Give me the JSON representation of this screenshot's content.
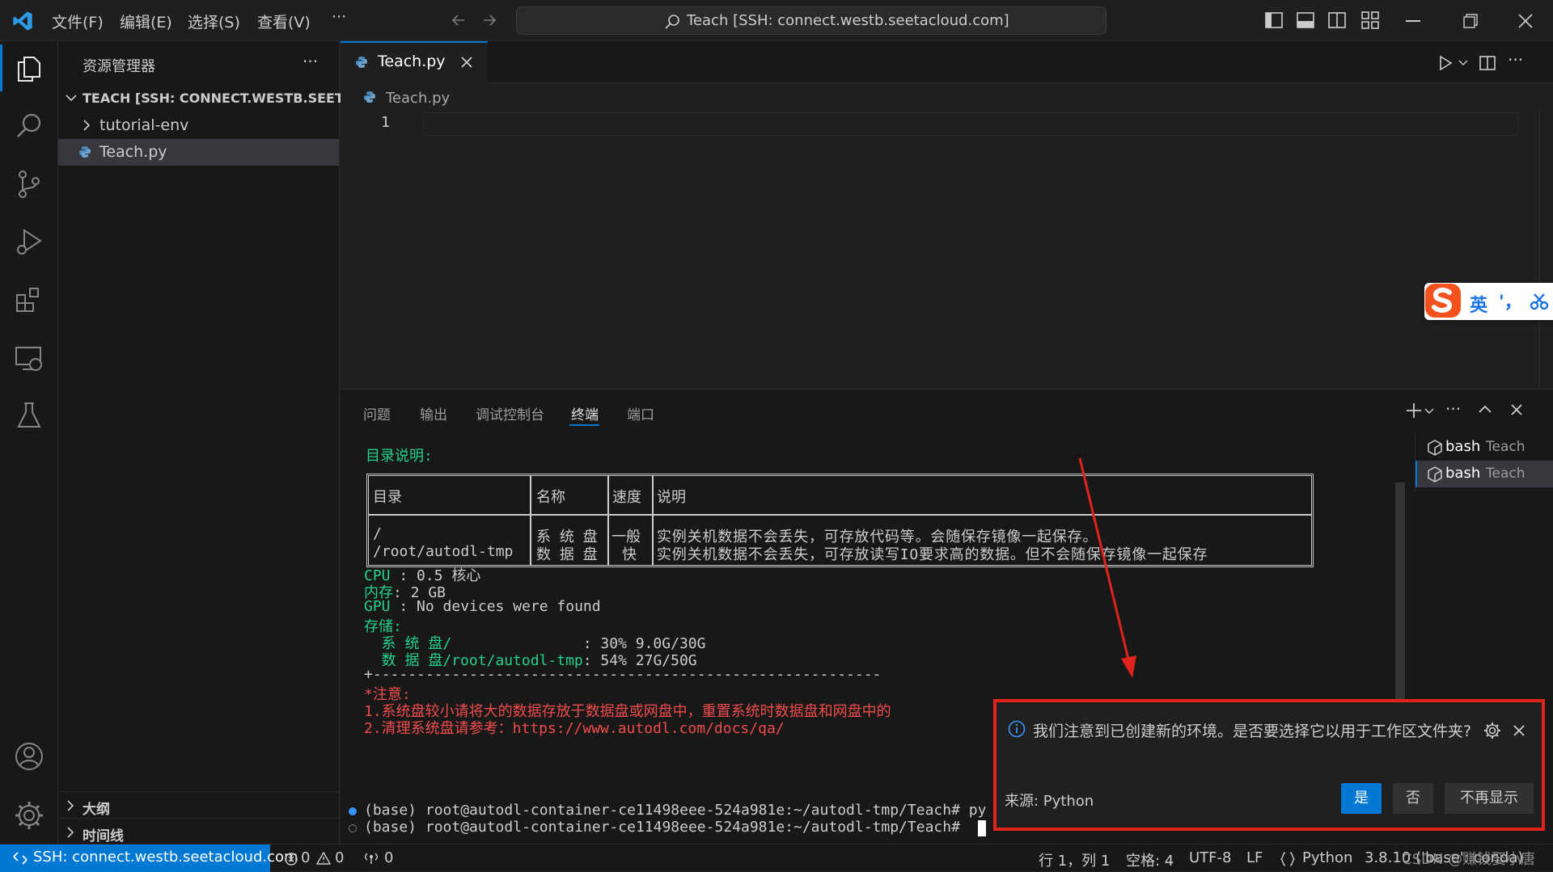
{
  "titlebar": {
    "menu": [
      "文件(F)",
      "编辑(E)",
      "选择(S)",
      "查看(V)",
      "···"
    ],
    "search_text": "Teach [SSH: connect.westb.seetacloud.com]"
  },
  "sidebar": {
    "title": "资源管理器",
    "more": "···",
    "folder_header": "TEACH [SSH: CONNECT.WESTB.SEETAC...",
    "items": [
      {
        "label": "tutorial-env",
        "type": "folder"
      },
      {
        "label": "Teach.py",
        "type": "file"
      }
    ],
    "outline_label": "大纲",
    "timeline_label": "时间线"
  },
  "editor": {
    "tab_label": "Teach.py",
    "breadcrumb": "Teach.py",
    "line_number": "1"
  },
  "ime": {
    "lang": "英",
    "punct": "'，"
  },
  "panel": {
    "tabs": [
      "问题",
      "输出",
      "调试控制台",
      "终端",
      "端口"
    ],
    "active_tab": "终端",
    "terminals": [
      {
        "name": "bash",
        "folder": "Teach"
      },
      {
        "name": "bash",
        "folder": "Teach"
      }
    ],
    "terminal": {
      "dir_heading": "目录说明:",
      "table_headers": [
        "目录",
        "名称",
        "速度",
        "说明"
      ],
      "table_col1": [
        "/",
        "/root/autodl-tmp"
      ],
      "table_col2": [
        "系 统 盘",
        "数 据 盘"
      ],
      "table_col3": [
        "一般",
        "快"
      ],
      "table_col4": [
        "实例关机数据不会丢失，可存放代码等。会随保存镜像一起保存。",
        "实例关机数据不会丢失，可存放读写IO要求高的数据。但不会随保存镜像一起保存"
      ],
      "cpu_label": "CPU",
      "cpu_value": " : 0.5 核心",
      "mem_label": "内存",
      "mem_value": ": 2 GB",
      "gpu_label": "GPU",
      "gpu_value": " : No devices were found",
      "storage_label": "存储:",
      "sys_disk_label": "  系 统 盘/",
      "sys_disk_value": "               : 30% 9.0G/30G",
      "data_disk_label": "  数 据 盘/root/autodl-tmp",
      "data_disk_value": ": 54% 27G/50G",
      "divider": "+----------------------------------------------------------",
      "notice": "*注意:",
      "notice_1": "1.系统盘较小请将大的数据存放于数据盘或网盘中，重置系统时数据盘和网盘中的",
      "notice_2": "2.清理系统盘请参考：https://www.autodl.com/docs/qa/",
      "prompt_1": "(base) root@autodl-container-ce11498eee-524a981e:~/autodl-tmp/Teach# py",
      "prompt_2": "(base) root@autodl-container-ce11498eee-524a981e:~/autodl-tmp/Teach# "
    }
  },
  "notification": {
    "message": "我们注意到已创建新的环境。是否要选择它以用于工作区文件夹?",
    "source": "来源: Python",
    "yes": "是",
    "no": "否",
    "never": "不再显示"
  },
  "statusbar": {
    "remote": "SSH: connect.westb.seetacloud.com",
    "errors": "0",
    "warnings": "0",
    "ports": "0",
    "position": "行 1，列 1",
    "spaces": "空格: 4",
    "encoding": "UTF-8",
    "eol": "LF",
    "language": "Python",
    "interpreter": "3.8.10 ('base': conda)",
    "watermark": "CSDN @赚钱娶小唐"
  },
  "colors": {
    "accent": "#0078d4",
    "terminal_green": "#23d18b",
    "terminal_red": "#f14c4c",
    "annotation_red": "#e0231c"
  }
}
